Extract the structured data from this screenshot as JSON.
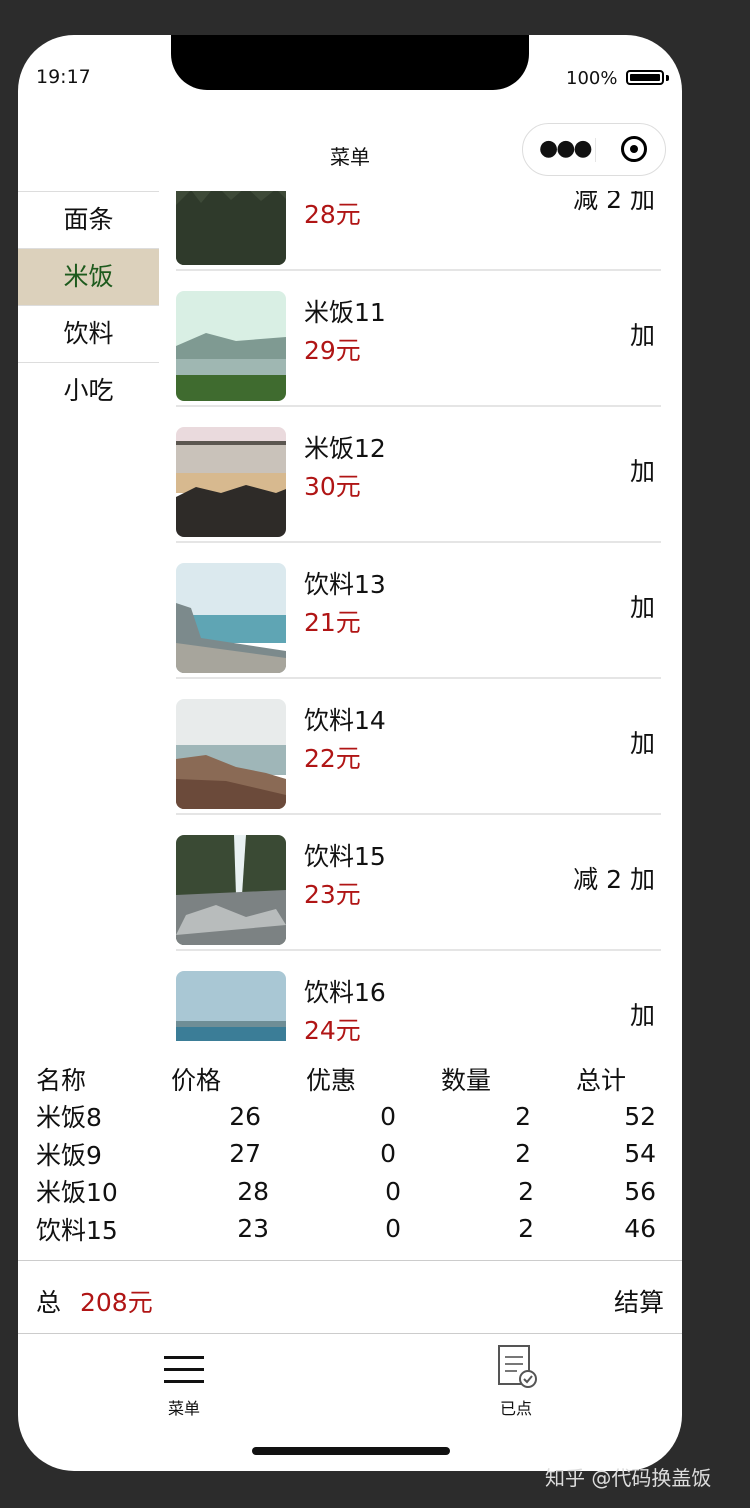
{
  "status": {
    "time": "19:17",
    "battery": "100%"
  },
  "nav": {
    "title": "菜单"
  },
  "sidebar": {
    "items": [
      {
        "label": "面条"
      },
      {
        "label": "米饭"
      },
      {
        "label": "饮料"
      },
      {
        "label": "小吃"
      }
    ]
  },
  "menu": {
    "items": [
      {
        "name": "",
        "price": "28元",
        "minus": "减",
        "qty": "2",
        "add": "加"
      },
      {
        "name": "米饭11",
        "price": "29元",
        "minus": "",
        "qty": "",
        "add": "加"
      },
      {
        "name": "米饭12",
        "price": "30元",
        "minus": "",
        "qty": "",
        "add": "加"
      },
      {
        "name": "饮料13",
        "price": "21元",
        "minus": "",
        "qty": "",
        "add": "加"
      },
      {
        "name": "饮料14",
        "price": "22元",
        "minus": "",
        "qty": "",
        "add": "加"
      },
      {
        "name": "饮料15",
        "price": "23元",
        "minus": "减",
        "qty": "2",
        "add": "加"
      },
      {
        "name": "饮料16",
        "price": "24元",
        "minus": "",
        "qty": "",
        "add": "加"
      }
    ]
  },
  "order": {
    "headers": [
      "名称",
      "价格",
      "优惠",
      "数量",
      "总计"
    ],
    "rows": [
      [
        "米饭8",
        "26",
        "0",
        "2",
        "52"
      ],
      [
        "米饭9",
        "27",
        "0",
        "2",
        "54"
      ],
      [
        "米饭10",
        "28",
        "0",
        "2",
        "56"
      ],
      [
        "饮料15",
        "23",
        "0",
        "2",
        "46"
      ]
    ]
  },
  "total": {
    "label": "总",
    "amount": "208元",
    "checkout": "结算"
  },
  "tabbar": {
    "menu": "菜单",
    "ordered": "已点"
  },
  "watermark": "知乎 @代码换盖饭",
  "colors": {
    "price": "#b01515",
    "active_bg": "#dcd1bc",
    "active_text": "#1d5a1d"
  }
}
